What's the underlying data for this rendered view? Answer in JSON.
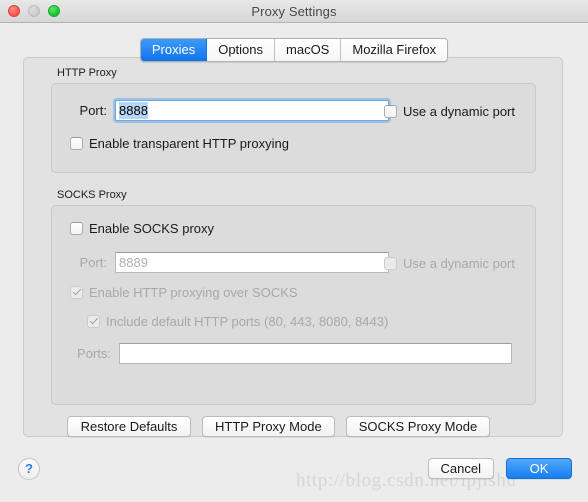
{
  "window": {
    "title": "Proxy Settings",
    "traffic_lights": [
      {
        "name": "close",
        "enabled": true,
        "color": "#ff5f57"
      },
      {
        "name": "minimize",
        "enabled": false,
        "color": "#cfcfcf"
      },
      {
        "name": "maximize",
        "enabled": true,
        "color": "#28c940"
      }
    ]
  },
  "tabs": [
    {
      "label": "Proxies",
      "active": true
    },
    {
      "label": "Options",
      "active": false
    },
    {
      "label": "macOS",
      "active": false
    },
    {
      "label": "Mozilla Firefox",
      "active": false
    }
  ],
  "http_proxy": {
    "group_title": "HTTP Proxy",
    "port_label": "Port:",
    "port_value": "8888",
    "port_focused": true,
    "port_selected": true,
    "dynamic_port_label": "Use a dynamic port",
    "dynamic_port_checked": false,
    "transparent_label": "Enable transparent HTTP proxying",
    "transparent_checked": false
  },
  "socks_proxy": {
    "group_title": "SOCKS Proxy",
    "enable_label": "Enable SOCKS proxy",
    "enable_checked": false,
    "port_label": "Port:",
    "port_value": "8889",
    "port_disabled": true,
    "dynamic_port_label": "Use a dynamic port",
    "dynamic_port_checked": false,
    "http_over_socks_label": "Enable HTTP proxying over SOCKS",
    "http_over_socks_checked": true,
    "default_ports_label": "Include default HTTP ports (80, 443, 8080, 8443)",
    "default_ports_checked": true,
    "ports_label": "Ports:",
    "ports_value": ""
  },
  "mode_buttons": [
    {
      "label": "Restore Defaults"
    },
    {
      "label": "HTTP Proxy Mode"
    },
    {
      "label": "SOCKS Proxy Mode"
    }
  ],
  "footer": {
    "help_label": "?",
    "cancel_label": "Cancel",
    "ok_label": "OK",
    "watermark": "http://blog.csdn.net/lpjishu"
  },
  "colors": {
    "accent": "#157ef0",
    "selection": "#b5d6f5",
    "disabled_text": "#a8a8a8"
  }
}
